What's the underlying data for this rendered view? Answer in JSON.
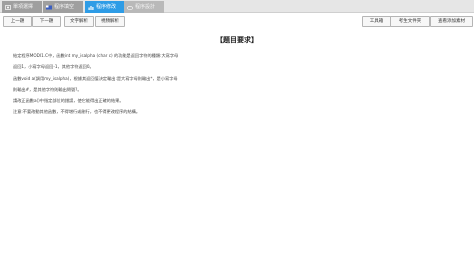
{
  "tabs": [
    {
      "label": "單項選擇",
      "icon": "cog-icon",
      "active": false
    },
    {
      "label": "程序填空",
      "icon": "flag-icon",
      "active": false
    },
    {
      "label": "程序修改",
      "icon": "chart-icon",
      "active": true
    },
    {
      "label": "程序設計",
      "icon": "cloud-icon",
      "active": false
    }
  ],
  "toolbar": {
    "prev_label": "上一題",
    "next_label": "下一題",
    "text_parse_label": "文字解析",
    "pic_parse_label": "視頻解析",
    "workspace_label": "工具箱",
    "folder_label": "考生文件夾",
    "more_label": "查看添加素材"
  },
  "content": {
    "title": "【題目要求】",
    "lines": [
      "給定程序MODI1.C中，函數int my_isalpha (char c) 的功能是返回字符的種類:大寫字母",
      "返回1，小寫字母返回-1，其他字符返回0。",
      "函數void a(調用my_isalpha)，根據其返回值決定輸出:是大寫字母則輸出*，是小寫字母",
      "則輸出#，是其他字符則輸出問號?。",
      "請改正函數a()中指定部位的錯誤，使它能得出正確的結果。",
      "注意:不要改動其他函數，不得增行或刪行，也不得更改程序的結構。"
    ]
  },
  "colors": {
    "active_tab": "#2e9ce6",
    "inactive_tab": "#9f9f9f",
    "topbar": "#e6e6e6"
  }
}
